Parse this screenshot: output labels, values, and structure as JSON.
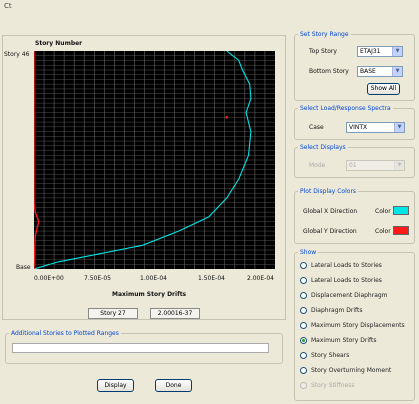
{
  "window": {
    "title": "Ct"
  },
  "chart": {
    "title": "Story Number",
    "y_top_label": "Story 46",
    "y_bottom_label": "Base",
    "x_tick_labels": [
      "0.00E+00",
      "7.50E-05",
      "1.00E-04",
      "1.50E-04",
      "2.00E-04"
    ],
    "xlabel": "Maximum Story Drifts",
    "readout_story": "Story 27",
    "readout_value": "2.00016-37"
  },
  "chart_data": {
    "type": "line",
    "title": "Story Number",
    "xlabel": "Maximum Story Drifts",
    "ylabel": "",
    "xlim": [
      0,
      0.0002
    ],
    "y_categories_range": [
      "Base",
      "Story 46"
    ],
    "grid": true,
    "series": [
      {
        "name": "Global X Direction",
        "color": "#00e5e5",
        "x": [
          0,
          2e-05,
          5e-05,
          9e-05,
          0.00012,
          0.000145,
          0.00016,
          0.00017,
          0.000178,
          0.00018,
          0.000176,
          0.00018,
          0.000179,
          0.000173,
          0.00017,
          0.00016
        ],
        "y": [
          0,
          1.5,
          3,
          5,
          8,
          11,
          15,
          19,
          24,
          29,
          33,
          36,
          39,
          42,
          44,
          46
        ]
      },
      {
        "name": "Global Y Direction",
        "color": "#ff1a1a",
        "x": [
          0,
          1e-06,
          4e-06,
          1e-06,
          0,
          0,
          0
        ],
        "y": [
          0,
          7,
          10,
          12,
          14,
          30,
          46
        ]
      }
    ]
  },
  "story_range": {
    "legend": "Set Story Range",
    "top_story_label": "Top Story",
    "top_story_value": "ETAJ31",
    "bottom_story_label": "Bottom Story",
    "bottom_story_value": "BASE",
    "show_all_label": "Show All"
  },
  "case": {
    "legend": "Select Load/Response Spectra",
    "label": "Case",
    "value": "VINTX"
  },
  "displays": {
    "legend": "Select Displays",
    "label": "Mode",
    "value": "01"
  },
  "display_colors": {
    "legend": "Plot Display Colors",
    "items": [
      {
        "label": "Global X Direction",
        "color_label": "Color",
        "color": "#00e5e5"
      },
      {
        "label": "Global Y Direction",
        "color_label": "Color",
        "color": "#ff1a1a"
      }
    ]
  },
  "show": {
    "legend": "Show",
    "options": [
      {
        "label": "Lateral Loads to Stories",
        "checked": false,
        "disabled": false
      },
      {
        "label": "Lateral Loads to Stories",
        "checked": false,
        "disabled": false
      },
      {
        "label": "Displacement Diaphragm",
        "checked": false,
        "disabled": false
      },
      {
        "label": "Diaphragm Drifts",
        "checked": false,
        "disabled": false
      },
      {
        "label": "Maximum Story Displacements",
        "checked": false,
        "disabled": false
      },
      {
        "label": "Maximum Story Drifts",
        "checked": true,
        "disabled": false
      },
      {
        "label": "Story Shears",
        "checked": false,
        "disabled": false
      },
      {
        "label": "Story Overturning Moment",
        "checked": false,
        "disabled": false
      },
      {
        "label": "Story Stiffness",
        "checked": false,
        "disabled": true
      }
    ]
  },
  "additional": {
    "legend": "Additional Stories to Plotted Ranges"
  },
  "footer": {
    "display_label": "Display",
    "done_label": "Done"
  }
}
